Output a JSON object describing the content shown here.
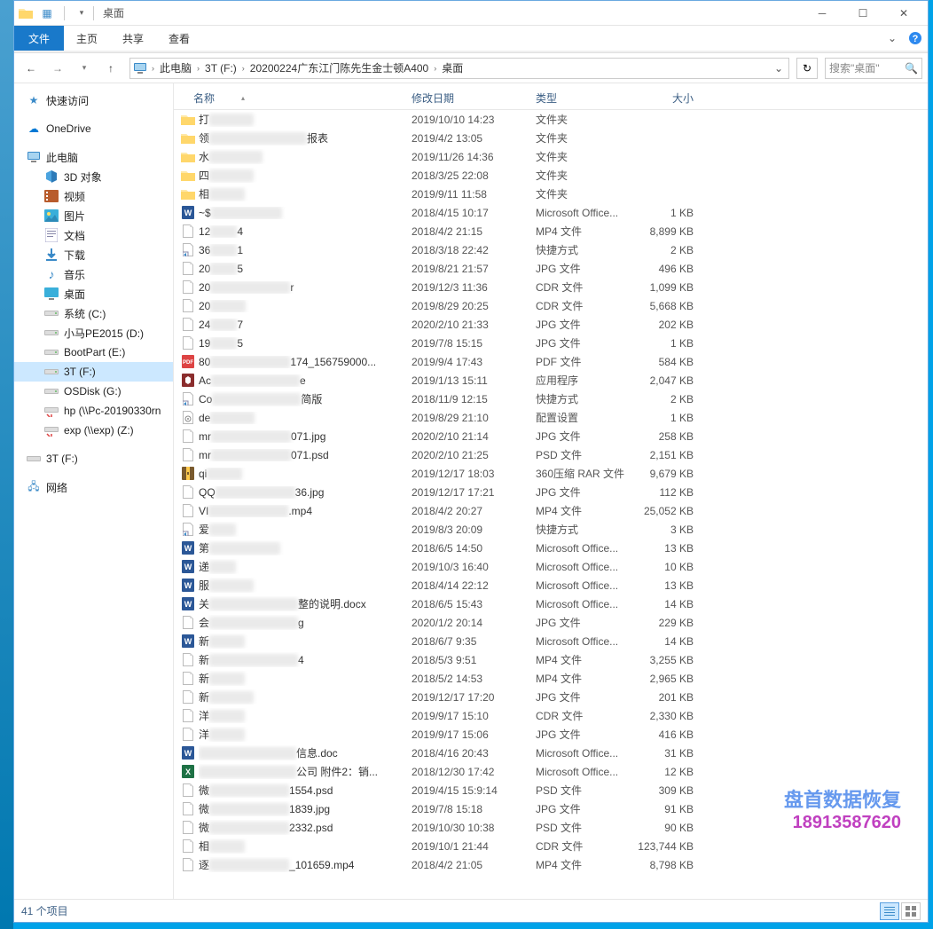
{
  "window": {
    "title": "桌面"
  },
  "ribbon": {
    "file": "文件",
    "tabs": [
      "主页",
      "共享",
      "查看"
    ]
  },
  "breadcrumb": {
    "segments": [
      "此电脑",
      "3T (F:)",
      "20200224广东江门陈先生金士顿A400",
      "桌面"
    ]
  },
  "search": {
    "placeholder": "搜索\"桌面\""
  },
  "nav": {
    "quick": "快速访问",
    "onedrive": "OneDrive",
    "thispc": "此电脑",
    "items": [
      {
        "label": "3D 对象",
        "ico": "3d"
      },
      {
        "label": "视频",
        "ico": "video"
      },
      {
        "label": "图片",
        "ico": "pic"
      },
      {
        "label": "文档",
        "ico": "doc"
      },
      {
        "label": "下载",
        "ico": "down"
      },
      {
        "label": "音乐",
        "ico": "music"
      },
      {
        "label": "桌面",
        "ico": "desk"
      },
      {
        "label": "系统 (C:)",
        "ico": "drive"
      },
      {
        "label": "小马PE2015 (D:)",
        "ico": "drive"
      },
      {
        "label": "BootPart (E:)",
        "ico": "drive"
      },
      {
        "label": "3T (F:)",
        "ico": "drive",
        "sel": true
      },
      {
        "label": "OSDisk (G:)",
        "ico": "drive"
      },
      {
        "label": "hp (\\\\Pc-20190330rn",
        "ico": "netdrive"
      },
      {
        "label": "exp (\\\\exp) (Z:)",
        "ico": "netdrive"
      }
    ],
    "drive_ext": "3T (F:)",
    "network": "网络"
  },
  "columns": {
    "name": "名称",
    "date": "修改日期",
    "type": "类型",
    "size": "大小"
  },
  "files": [
    {
      "ico": "folder",
      "start": "打",
      "blur": 50,
      "end": "",
      "date": "2019/10/10 14:23",
      "type": "文件夹",
      "size": ""
    },
    {
      "ico": "folder",
      "start": "领",
      "blur": 110,
      "end": "报表",
      "date": "2019/4/2 13:05",
      "type": "文件夹",
      "size": ""
    },
    {
      "ico": "folder",
      "start": "水",
      "blur": 60,
      "end": "",
      "date": "2019/11/26 14:36",
      "type": "文件夹",
      "size": ""
    },
    {
      "ico": "folder",
      "start": "四",
      "blur": 50,
      "end": "",
      "date": "2018/3/25 22:08",
      "type": "文件夹",
      "size": ""
    },
    {
      "ico": "folder",
      "start": "相",
      "blur": 40,
      "end": "",
      "date": "2019/9/11 11:58",
      "type": "文件夹",
      "size": ""
    },
    {
      "ico": "docf",
      "start": "~$",
      "blur": 80,
      "end": "",
      "date": "2018/4/15 10:17",
      "type": "Microsoft Office...",
      "size": "1 KB"
    },
    {
      "ico": "file",
      "start": "12",
      "blur": 30,
      "end": "4",
      "date": "2018/4/2 21:15",
      "type": "MP4 文件",
      "size": "8,899 KB"
    },
    {
      "ico": "lnk",
      "start": "36",
      "blur": 30,
      "end": "1",
      "date": "2018/3/18 22:42",
      "type": "快捷方式",
      "size": "2 KB"
    },
    {
      "ico": "file",
      "start": "20",
      "blur": 30,
      "end": "5",
      "date": "2019/8/21 21:57",
      "type": "JPG 文件",
      "size": "496 KB"
    },
    {
      "ico": "file",
      "start": "20",
      "blur": 90,
      "end": "r",
      "date": "2019/12/3 11:36",
      "type": "CDR 文件",
      "size": "1,099 KB"
    },
    {
      "ico": "file",
      "start": "20",
      "blur": 40,
      "end": "",
      "date": "2019/8/29 20:25",
      "type": "CDR 文件",
      "size": "5,668 KB"
    },
    {
      "ico": "file",
      "start": "24",
      "blur": 30,
      "end": "7",
      "date": "2020/2/10 21:33",
      "type": "JPG 文件",
      "size": "202 KB"
    },
    {
      "ico": "file",
      "start": "19",
      "blur": 30,
      "end": "5",
      "date": "2019/7/8 15:15",
      "type": "JPG 文件",
      "size": "1 KB"
    },
    {
      "ico": "pdf",
      "start": "80",
      "blur": 90,
      "end": "174_156759000...",
      "date": "2019/9/4 17:43",
      "type": "PDF 文件",
      "size": "584 KB"
    },
    {
      "ico": "exe",
      "start": "Ac",
      "blur": 100,
      "end": "e",
      "date": "2019/1/13 15:11",
      "type": "应用程序",
      "size": "2,047 KB"
    },
    {
      "ico": "lnk",
      "start": "Co",
      "blur": 100,
      "end": "简版",
      "date": "2018/11/9 12:15",
      "type": "快捷方式",
      "size": "2 KB"
    },
    {
      "ico": "ini",
      "start": "de",
      "blur": 50,
      "end": "",
      "date": "2019/8/29 21:10",
      "type": "配置设置",
      "size": "1 KB"
    },
    {
      "ico": "file",
      "start": "mr",
      "blur": 90,
      "end": "071.jpg",
      "date": "2020/2/10 21:14",
      "type": "JPG 文件",
      "size": "258 KB"
    },
    {
      "ico": "file",
      "start": "mr",
      "blur": 90,
      "end": "071.psd",
      "date": "2020/2/10 21:25",
      "type": "PSD 文件",
      "size": "2,151 KB"
    },
    {
      "ico": "rar",
      "start": "qi",
      "blur": 40,
      "end": "",
      "date": "2019/12/17 18:03",
      "type": "360压缩 RAR 文件",
      "size": "9,679 KB"
    },
    {
      "ico": "file",
      "start": "QQ",
      "blur": 90,
      "end": "36.jpg",
      "date": "2019/12/17 17:21",
      "type": "JPG 文件",
      "size": "112 KB"
    },
    {
      "ico": "file",
      "start": "VI",
      "blur": 90,
      "end": ".mp4",
      "date": "2018/4/2 20:27",
      "type": "MP4 文件",
      "size": "25,052 KB"
    },
    {
      "ico": "lnk",
      "start": "爱",
      "blur": 30,
      "end": "",
      "date": "2019/8/3 20:09",
      "type": "快捷方式",
      "size": "3 KB"
    },
    {
      "ico": "docf",
      "start": "第",
      "blur": 80,
      "end": "",
      "date": "2018/6/5 14:50",
      "type": "Microsoft Office...",
      "size": "13 KB"
    },
    {
      "ico": "docf",
      "start": "递",
      "blur": 30,
      "end": "",
      "date": "2019/10/3 16:40",
      "type": "Microsoft Office...",
      "size": "10 KB"
    },
    {
      "ico": "docf",
      "start": "服",
      "blur": 50,
      "end": "",
      "date": "2018/4/14 22:12",
      "type": "Microsoft Office...",
      "size": "13 KB"
    },
    {
      "ico": "docf",
      "start": "关",
      "blur": 100,
      "end": "整的说明.docx",
      "date": "2018/6/5 15:43",
      "type": "Microsoft Office...",
      "size": "14 KB"
    },
    {
      "ico": "file",
      "start": "会",
      "blur": 100,
      "end": "g",
      "date": "2020/1/2 20:14",
      "type": "JPG 文件",
      "size": "229 KB"
    },
    {
      "ico": "docf",
      "start": "新",
      "blur": 40,
      "end": "",
      "date": "2018/6/7 9:35",
      "type": "Microsoft Office...",
      "size": "14 KB"
    },
    {
      "ico": "file",
      "start": "新",
      "blur": 100,
      "end": "4",
      "date": "2018/5/3 9:51",
      "type": "MP4 文件",
      "size": "3,255 KB"
    },
    {
      "ico": "file",
      "start": "新",
      "blur": 40,
      "end": "",
      "date": "2018/5/2 14:53",
      "type": "MP4 文件",
      "size": "2,965 KB"
    },
    {
      "ico": "file",
      "start": "新",
      "blur": 50,
      "end": "",
      "date": "2019/12/17 17:20",
      "type": "JPG 文件",
      "size": "201 KB"
    },
    {
      "ico": "file",
      "start": "洋",
      "blur": 40,
      "end": "",
      "date": "2019/9/17 15:10",
      "type": "CDR 文件",
      "size": "2,330 KB"
    },
    {
      "ico": "file",
      "start": "洋",
      "blur": 40,
      "end": "",
      "date": "2019/9/17 15:06",
      "type": "JPG 文件",
      "size": "416 KB"
    },
    {
      "ico": "docf",
      "start": "",
      "blur": 110,
      "end": "信息.doc",
      "date": "2018/4/16 20:43",
      "type": "Microsoft Office...",
      "size": "31 KB"
    },
    {
      "ico": "xls",
      "start": "",
      "blur": 110,
      "end": "公司 附件2：销...",
      "date": "2018/12/30 17:42",
      "type": "Microsoft Office...",
      "size": "12 KB"
    },
    {
      "ico": "file",
      "start": "微",
      "blur": 90,
      "end": "1554.psd",
      "date": "2019/4/15 15:9:14",
      "type": "PSD 文件",
      "size": "309 KB"
    },
    {
      "ico": "file",
      "start": "微",
      "blur": 90,
      "end": "1839.jpg",
      "date": "2019/7/8 15:18",
      "type": "JPG 文件",
      "size": "91 KB"
    },
    {
      "ico": "file",
      "start": "微",
      "blur": 90,
      "end": "2332.psd",
      "date": "2019/10/30 10:38",
      "type": "PSD 文件",
      "size": "90 KB"
    },
    {
      "ico": "file",
      "start": "相",
      "blur": 40,
      "end": "",
      "date": "2019/10/1 21:44",
      "type": "CDR 文件",
      "size": "123,744 KB"
    },
    {
      "ico": "file",
      "start": "逐",
      "blur": 90,
      "end": "_101659.mp4",
      "date": "2018/4/2 21:05",
      "type": "MP4 文件",
      "size": "8,798 KB"
    }
  ],
  "status": {
    "text": "41 个项目"
  },
  "watermark": {
    "line1": "盘首数据恢复",
    "line2": "18913587620"
  }
}
